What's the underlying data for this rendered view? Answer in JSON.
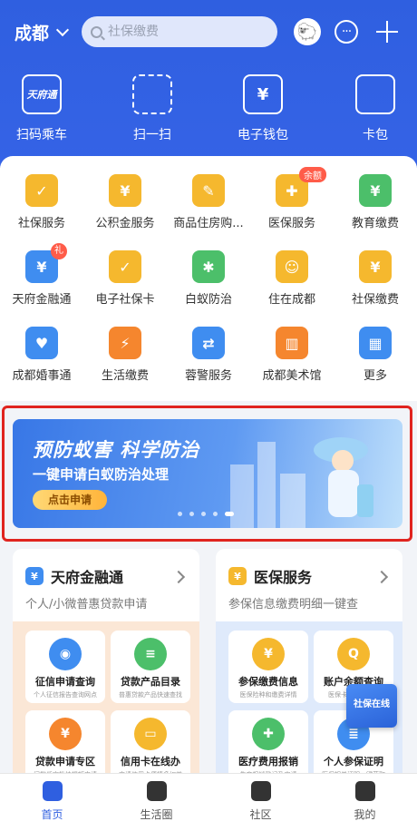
{
  "header": {
    "city": "成都",
    "search_placeholder": "社保缴费",
    "quick_actions": [
      {
        "label": "扫码乘车",
        "icon": "transit-card-icon",
        "glyph": "天府通"
      },
      {
        "label": "扫一扫",
        "icon": "scan-icon",
        "glyph": ""
      },
      {
        "label": "电子钱包",
        "icon": "wallet-yen-icon",
        "glyph": "¥"
      },
      {
        "label": "卡包",
        "icon": "card-wallet-icon",
        "glyph": ""
      }
    ]
  },
  "services": [
    {
      "label": "社保服务",
      "icon": "shield-check-icon",
      "color": "#f5b82e",
      "glyph": "✓"
    },
    {
      "label": "公积金服务",
      "icon": "house-yen-icon",
      "color": "#f5b82e",
      "glyph": "¥"
    },
    {
      "label": "商品住房购...",
      "icon": "house-edit-icon",
      "color": "#f5b82e",
      "glyph": "✎"
    },
    {
      "label": "医保服务",
      "icon": "medical-shield-icon",
      "color": "#f5b82e",
      "glyph": "✚",
      "badge": "余额"
    },
    {
      "label": "教育缴费",
      "icon": "school-bag-icon",
      "color": "#4cbf6a",
      "glyph": "¥"
    },
    {
      "label": "天府金融通",
      "icon": "money-bag-icon",
      "color": "#3f8df0",
      "glyph": "¥",
      "badge": "礼"
    },
    {
      "label": "电子社保卡",
      "icon": "social-card-icon",
      "color": "#f5b82e",
      "glyph": "✓"
    },
    {
      "label": "白蚁防治",
      "icon": "termite-icon",
      "color": "#4cbf6a",
      "glyph": "✱"
    },
    {
      "label": "住在成都",
      "icon": "panda-house-icon",
      "color": "#f5b82e",
      "glyph": "☺"
    },
    {
      "label": "社保缴费",
      "icon": "payment-icon",
      "color": "#f5b82e",
      "glyph": "¥"
    },
    {
      "label": "成都婚事通",
      "icon": "marriage-icon",
      "color": "#3f8df0",
      "glyph": "♥"
    },
    {
      "label": "生活缴费",
      "icon": "lightning-icon",
      "color": "#f5862e",
      "glyph": "⚡"
    },
    {
      "label": "蓉警服务",
      "icon": "police-id-icon",
      "color": "#3f8df0",
      "glyph": "⇄"
    },
    {
      "label": "成都美术馆",
      "icon": "museum-icon",
      "color": "#f5862e",
      "glyph": "▥"
    },
    {
      "label": "更多",
      "icon": "grid-more-icon",
      "color": "#3f8df0",
      "glyph": "▦"
    }
  ],
  "banner": {
    "title": "预防蚁害 科学防治",
    "subtitle": "一键申请白蚁防治处理",
    "button": "点击申请",
    "slides": 5,
    "active_slide": 5
  },
  "cards": [
    {
      "title": "天府金融通",
      "subtitle": "个人/小微普惠贷款申请",
      "icon": "money-bag-icon",
      "icon_color": "#3f8df0",
      "bg": "#fbe7d6",
      "tiles": [
        {
          "name": "征信申请查询",
          "desc": "个人征信报告查询网点",
          "icon": "location-pin-icon",
          "color": "#3f8df0",
          "glyph": "◉"
        },
        {
          "name": "贷款产品目录",
          "desc": "普惠贷款产品快速查找",
          "icon": "list-icon",
          "color": "#4cbf6a",
          "glyph": "≡"
        },
        {
          "name": "贷款申请专区",
          "desc": "门槛低审批快提额申请",
          "icon": "loan-bag-icon",
          "color": "#f5862e",
          "glyph": "¥"
        },
        {
          "name": "信用卡在线办",
          "desc": "申请信用卡便捷多权益",
          "icon": "credit-card-icon",
          "color": "#f5b82e",
          "glyph": "▭"
        }
      ]
    },
    {
      "title": "医保服务",
      "subtitle": "参保信息缴费明细一键查",
      "icon": "medical-shield-icon",
      "icon_color": "#f5b82e",
      "bg": "#dfeafb",
      "tiles": [
        {
          "name": "参保缴费信息",
          "desc": "医保险种和缴费详情",
          "icon": "insurance-doc-icon",
          "color": "#f5b82e",
          "glyph": "¥"
        },
        {
          "name": "账户余额查询",
          "desc": "医保卡通账户余额",
          "icon": "search-person-icon",
          "color": "#f5b82e",
          "glyph": "Q"
        },
        {
          "name": "医疗费用报销",
          "desc": "生育报销登记及申请",
          "icon": "medical-bottle-icon",
          "color": "#4cbf6a",
          "glyph": "✚"
        },
        {
          "name": "个人参保证明",
          "desc": "医保相关证明一键获取",
          "icon": "certificate-icon",
          "color": "#3f8df0",
          "glyph": "≣"
        }
      ]
    }
  ],
  "floating": {
    "label": "社保在线"
  },
  "tabs": [
    {
      "label": "首页",
      "icon": "home-icon",
      "active": true
    },
    {
      "label": "生活圈",
      "icon": "heart-circle-icon",
      "active": false
    },
    {
      "label": "社区",
      "icon": "community-icon",
      "active": false
    },
    {
      "label": "我的",
      "icon": "profile-icon",
      "active": false
    }
  ]
}
